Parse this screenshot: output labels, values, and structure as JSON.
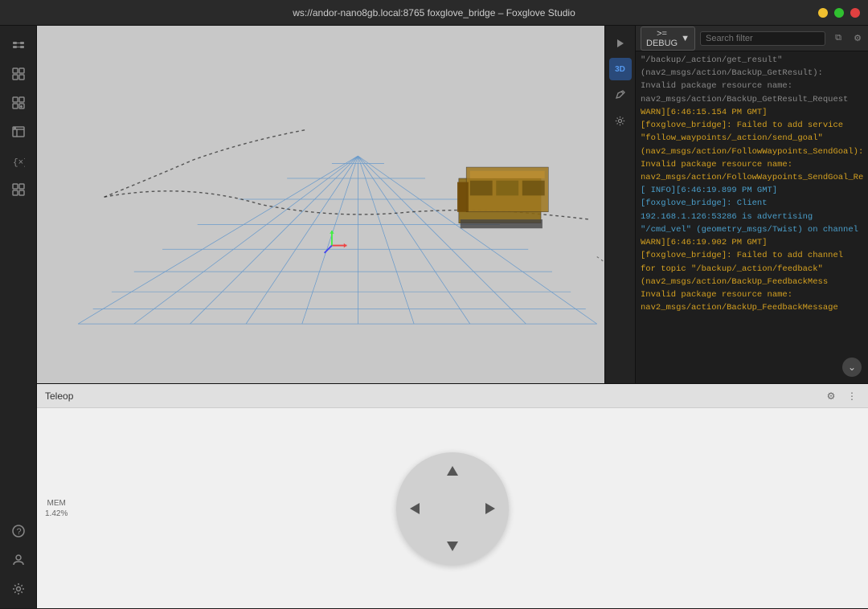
{
  "titlebar": {
    "title": "ws://andor-nano8gb.local:8765 foxglove_bridge – Foxglove Studio"
  },
  "sidebar": {
    "items": [
      {
        "name": "connection-icon",
        "glyph": "⊞",
        "label": "Connection"
      },
      {
        "name": "layout-icon",
        "glyph": "▦",
        "label": "Layout"
      },
      {
        "name": "add-panel-icon",
        "glyph": "⊕",
        "label": "Add Panel"
      },
      {
        "name": "panel-settings-icon",
        "glyph": "⊡",
        "label": "Panel Settings"
      },
      {
        "name": "variables-icon",
        "glyph": "{×}",
        "label": "Variables"
      },
      {
        "name": "extensions-icon",
        "glyph": "⊞",
        "label": "Extensions"
      }
    ],
    "bottom_items": [
      {
        "name": "help-icon",
        "glyph": "?",
        "label": "Help"
      },
      {
        "name": "account-icon",
        "glyph": "◯",
        "label": "Account"
      },
      {
        "name": "settings-icon",
        "glyph": "⚙",
        "label": "Settings"
      }
    ]
  },
  "viewport": {
    "label": "3D"
  },
  "right_tools": {
    "items": [
      {
        "name": "play-icon",
        "glyph": "▶",
        "active": false
      },
      {
        "name": "3d-icon",
        "glyph": "3D",
        "active": true
      },
      {
        "name": "pencil-icon",
        "glyph": "✏",
        "active": false
      },
      {
        "name": "gear-icon",
        "glyph": "⚙",
        "active": false
      }
    ]
  },
  "log_panel": {
    "level_label": ">= DEBUG",
    "search_placeholder": "Search filter",
    "lines": [
      {
        "type": "debug",
        "text": "\"/backup/_action/get_result\""
      },
      {
        "type": "debug",
        "text": "(nav2_msgs/action/BackUp_GetResult):"
      },
      {
        "type": "debug",
        "text": "Invalid package resource name:"
      },
      {
        "type": "debug",
        "text": "nav2_msgs/action/BackUp_GetResult_Request"
      },
      {
        "type": "warn",
        "text": "WARN][6:46:15.154 PM GMT]"
      },
      {
        "type": "warn",
        "text": "[foxglove_bridge]: Failed to add service"
      },
      {
        "type": "warn",
        "text": "\"follow_waypoints/_action/send_goal\""
      },
      {
        "type": "warn",
        "text": "(nav2_msgs/action/FollowWaypoints_SendGoal):"
      },
      {
        "type": "warn",
        "text": "Invalid package resource name:"
      },
      {
        "type": "warn",
        "text": "nav2_msgs/action/FollowWaypoints_SendGoal_Re"
      },
      {
        "type": "info",
        "text": "[ INFO][6:46:19.899 PM GMT]"
      },
      {
        "type": "info",
        "text": "[foxglove_bridge]: Client"
      },
      {
        "type": "info",
        "text": "192.168.1.126:53286 is advertising"
      },
      {
        "type": "info",
        "text": "\"/cmd_vel\" (geometry_msgs/Twist) on channel"
      },
      {
        "type": "warn",
        "text": "WARN][6:46:19.902 PM GMT]"
      },
      {
        "type": "warn",
        "text": "[foxglove_bridge]: Failed to add channel"
      },
      {
        "type": "warn",
        "text": "for topic \"/backup/_action/feedback\""
      },
      {
        "type": "warn",
        "text": "(nav2_msgs/action/BackUp_FeedbackMess"
      },
      {
        "type": "warn",
        "text": "Invalid package resource name:"
      },
      {
        "type": "warn",
        "text": "nav2_msgs/action/BackUp_FeedbackMessage"
      }
    ]
  },
  "teleop": {
    "title": "Teleop",
    "mem_label": "MEM",
    "mem_value": "1.42%"
  }
}
